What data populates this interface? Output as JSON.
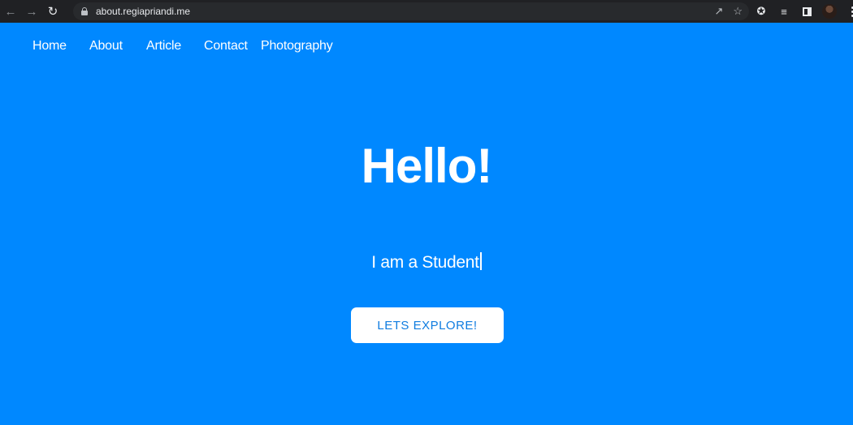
{
  "browser": {
    "url": "about.regiapriandi.me",
    "icons": [
      "back-arrow-icon",
      "forward-arrow-icon",
      "reload-icon",
      "lock-icon",
      "share-icon",
      "star-icon",
      "extensions-icon",
      "media-queue-icon",
      "side-panel-icon",
      "profile-avatar",
      "kebab-menu-icon"
    ]
  },
  "nav": {
    "items": [
      {
        "label": "Home"
      },
      {
        "label": "About"
      },
      {
        "label": "Article"
      },
      {
        "label": "Contact"
      },
      {
        "label": "Photography"
      }
    ]
  },
  "hero": {
    "title": "Hello!",
    "subtitle": "I am a Student",
    "cta_label": "LETS EXPLORE!"
  },
  "colors": {
    "background": "#0088ff",
    "button_text": "#0f7ce0",
    "browser_chrome": "#202124"
  }
}
